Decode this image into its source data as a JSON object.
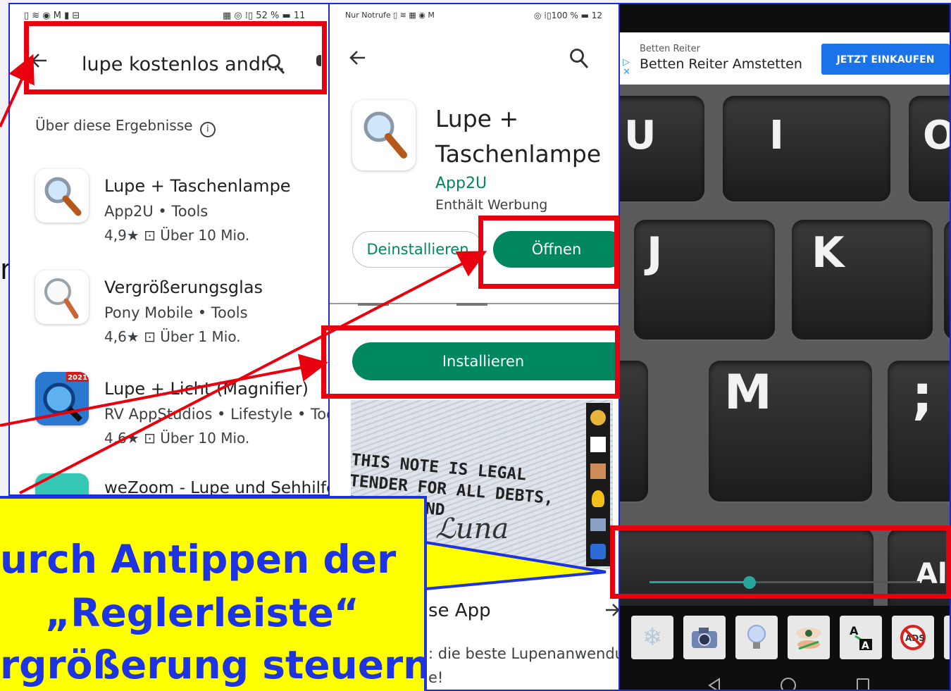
{
  "left_panel": {
    "status_icons": "▯ ≋ ◉ M ▮ ⊟",
    "status_right": "▦ ◎ ⁞▯ 52 % ▬ 11",
    "search_query": "lupe kostenlos andr...",
    "results_header": "Über diese Ergebnisse",
    "results": [
      {
        "name": "Lupe + Taschenlampe",
        "meta": "App2U • Tools",
        "stats": "4,9★  ⊡ Über 10 Mio."
      },
      {
        "name": "Vergrößerungsglas",
        "meta": "Pony Mobile • Tools",
        "stats": "4,6★  ⊡ Über 1 Mio."
      },
      {
        "name": "Lupe + Licht (Magnifier)",
        "meta": "RV AppStudios • Lifestyle • Tools",
        "stats": "4,6★  ⊡ Über 10 Mio.",
        "badge": "2021"
      },
      {
        "name": "weZoom - Lupe und Sehhilfe",
        "meta": "",
        "stats": ""
      }
    ]
  },
  "middle_panel": {
    "status_left": "Nur Notrufe ▯ ≋ ▦ ◉ M",
    "status_right": "◎ ⁞▯100 % ▬ 12",
    "app_title": "Lupe + Taschenlampe",
    "developer": "App2U",
    "ads_note": "Enthält Werbung",
    "uninstall_label": "Deinstallieren",
    "open_label": "Öffnen",
    "install_label": "Installieren",
    "screenshot_text": "THIS NOTE IS LEGAL TENDER FOR ALL DEBTS, PUBLIC AND",
    "about_title": "se App",
    "about_text": ": die beste Lupenanwendung",
    "about_text2": "e!"
  },
  "right_panel": {
    "ad_source": "Betten Reiter",
    "ad_title": "Betten Reiter Amstetten",
    "ad_button": "JETZT EINKAUFEN",
    "keys": {
      "u": "U",
      "i": "I",
      "o": "O",
      "j": "J",
      "k": "K",
      "m": "M",
      "semicolon": ";",
      "alt": "Al"
    },
    "slider_value": 0.37
  },
  "callout": {
    "line1": "urch Antippen der",
    "line2": "„Reglerleiste“",
    "line3": "rgrößerung steuern!"
  },
  "colors": {
    "accent_green": "#01875f",
    "annotation_red": "#e8000f",
    "callout_yellow": "#ffff00",
    "callout_text": "#1d34e0",
    "panel_border": "#1c2ad6"
  }
}
